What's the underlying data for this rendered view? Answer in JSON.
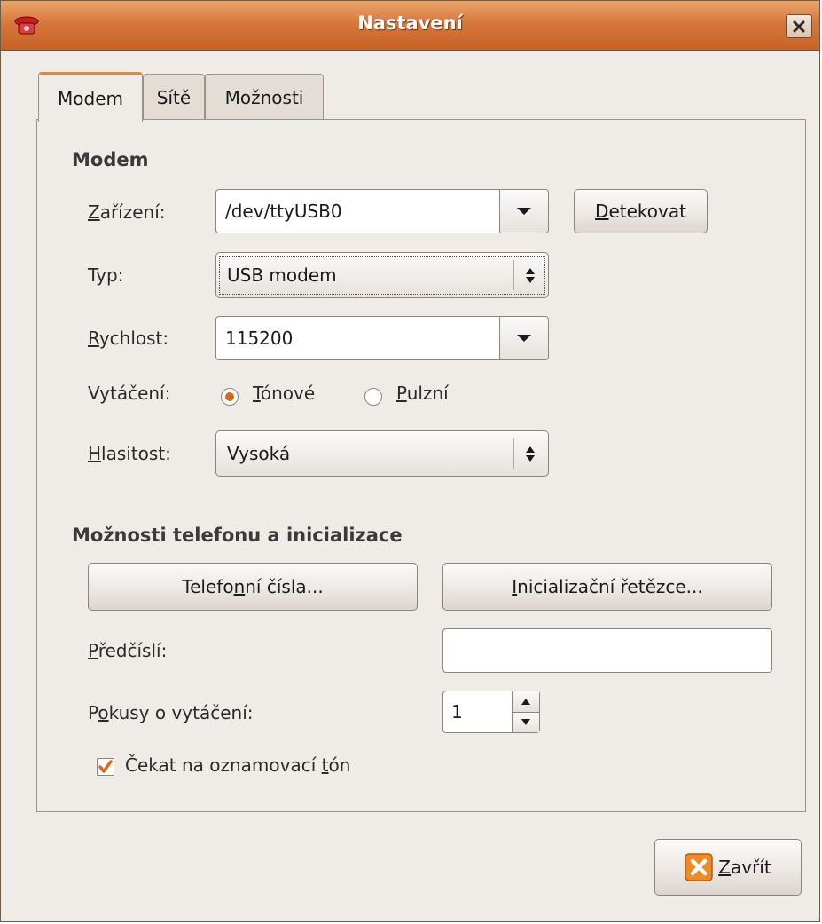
{
  "window": {
    "title": "Nastavení"
  },
  "tabs": [
    {
      "label": "Modem",
      "active": true
    },
    {
      "label": "Sítě",
      "active": false
    },
    {
      "label": "Možnosti",
      "active": false
    }
  ],
  "modem": {
    "section_title": "Modem",
    "device": {
      "label_mnemonic": "Z",
      "label_rest": "ařízení:",
      "value": "/dev/ttyUSB0"
    },
    "detect_button": {
      "mnemonic": "D",
      "rest": "etekovat"
    },
    "type": {
      "label": "Typ:",
      "value": "USB modem"
    },
    "speed": {
      "label_mnemonic": "R",
      "label_rest": "ychlost:",
      "value": "115200"
    },
    "dialing": {
      "label": "Vytáčení:",
      "options": [
        {
          "mnemonic": "T",
          "rest": "ónové",
          "selected": true
        },
        {
          "mnemonic": "P",
          "rest": "ulzní",
          "selected": false
        }
      ]
    },
    "volume": {
      "label_mnemonic": "H",
      "label_rest": "lasitost:",
      "value": "Vysoká"
    }
  },
  "phone": {
    "section_title": "Možnosti telefonu a inicializace",
    "numbers_button": {
      "pre": "Telefo",
      "mnemonic": "n",
      "post": "ní čísla..."
    },
    "init_button": {
      "mnemonic": "I",
      "rest": "nicializační řetězce..."
    },
    "prefix": {
      "label_mnemonic": "P",
      "label_rest": "ředčíslí:",
      "value": ""
    },
    "attempts": {
      "label_pre": "P",
      "label_mnemonic": "o",
      "label_post": "kusy o vytáčení:",
      "value": "1"
    },
    "wait_tone": {
      "pre": "Čekat na oznamovací ",
      "mnemonic": "t",
      "post": "ón",
      "checked": true
    }
  },
  "close_button": {
    "mnemonic": "Z",
    "rest": "avřít"
  },
  "colors": {
    "titlebar": "#d8773a",
    "accent": "#d9691c",
    "background": "#efebe7"
  },
  "icons": {
    "app": "telephone-icon",
    "window_close": "close-icon",
    "close_button": "close-x-icon"
  }
}
